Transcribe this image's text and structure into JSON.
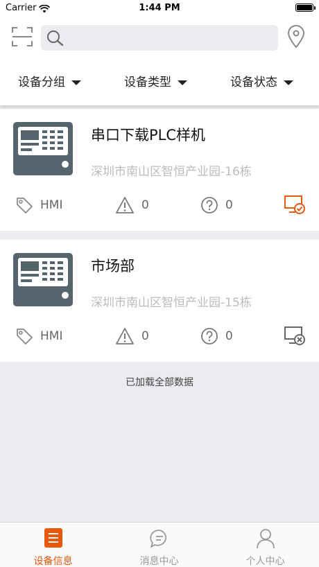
{
  "status_bar": {
    "carrier": "Carrier",
    "time": "1:44 PM"
  },
  "header": {
    "scan_icon": "scan-icon",
    "search": {
      "placeholder": "",
      "value": ""
    },
    "location_icon": "location-pin-icon"
  },
  "filters": [
    {
      "label": "设备分组"
    },
    {
      "label": "设备类型"
    },
    {
      "label": "设备状态"
    }
  ],
  "devices": [
    {
      "name": "串口下载PLC样机",
      "address": "深圳市南山区智恒产业园-16栋",
      "tag": "HMI",
      "alarm_count": "0",
      "unknown_count": "0",
      "online": true
    },
    {
      "name": "市场部",
      "address": "深圳市南山区智恒产业园-15栋",
      "tag": "HMI",
      "alarm_count": "0",
      "unknown_count": "0",
      "online": false
    }
  ],
  "loaded_text": "已加载全部数据",
  "tabs": [
    {
      "label": "设备信息",
      "icon": "device-list-icon",
      "active": true
    },
    {
      "label": "消息中心",
      "icon": "message-icon",
      "active": false
    },
    {
      "label": "个人中心",
      "icon": "person-icon",
      "active": false
    }
  ],
  "colors": {
    "accent": "#e8590c",
    "device_image": "#56656d",
    "inactive": "#999999"
  }
}
